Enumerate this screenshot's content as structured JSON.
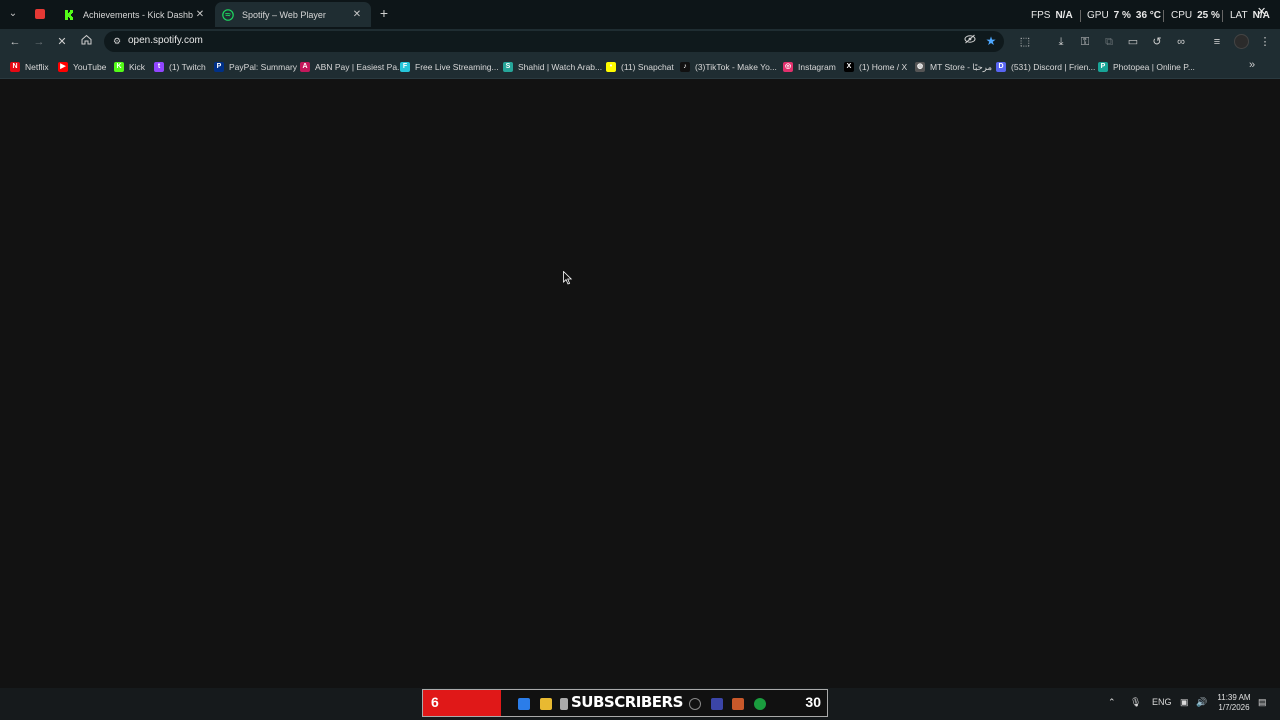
{
  "browser": {
    "tabs": [
      {
        "label": "Achievements - Kick Dashboard",
        "icon": "kick-icon",
        "color": "#53fc18"
      },
      {
        "label": "Spotify – Web Player",
        "icon": "spotify-icon",
        "color": "#1ed760",
        "active": true
      }
    ],
    "perf": {
      "fps_label": "FPS",
      "fps_value": "N/A",
      "gpu_label": "GPU",
      "gpu_value": "7 %",
      "gpu_temp": "36 °C",
      "cpu_label": "CPU",
      "cpu_value": "25 %",
      "lat_label": "LAT",
      "lat_value": "N/A"
    },
    "address": {
      "url": "open.spotify.com"
    },
    "bookmarks": [
      {
        "label": "Netflix",
        "color": "#e50914",
        "glyph": "N"
      },
      {
        "label": "YouTube",
        "color": "#ff0000",
        "glyph": "▶"
      },
      {
        "label": "Kick",
        "color": "#53fc18",
        "glyph": "K"
      },
      {
        "label": "(1) Twitch",
        "color": "#9146ff",
        "glyph": "t"
      },
      {
        "label": "PayPal: Summary",
        "color": "#003087",
        "glyph": "P"
      },
      {
        "label": "ABN Pay | Easiest Pa...",
        "color": "#c2185b",
        "glyph": "A"
      },
      {
        "label": "Free Live Streaming...",
        "color": "#26c6da",
        "glyph": "F"
      },
      {
        "label": "Shahid | Watch Arab...",
        "color": "#26a69a",
        "glyph": "S"
      },
      {
        "label": "(11) Snapchat",
        "color": "#fffc00",
        "glyph": "•"
      },
      {
        "label": "(3)TikTok - Make Yo...",
        "color": "#111111",
        "glyph": "♪"
      },
      {
        "label": "Instagram",
        "color": "#e1306c",
        "glyph": "◎"
      },
      {
        "label": "(1) Home / X",
        "color": "#000000",
        "glyph": "X"
      },
      {
        "label": "MT Store - مرحبًا",
        "color": "#555555",
        "glyph": "◍"
      },
      {
        "label": "(531) Discord | Frien...",
        "color": "#5865f2",
        "glyph": "D"
      },
      {
        "label": "Photopea | Online P...",
        "color": "#18a497",
        "glyph": "P"
      }
    ]
  },
  "taskbar": {
    "sub_left": "6",
    "sub_label": "SUBSCRIBERS",
    "sub_right": "30",
    "lang": "ENG",
    "time": "11:39 AM",
    "date": "1/7/2026"
  }
}
